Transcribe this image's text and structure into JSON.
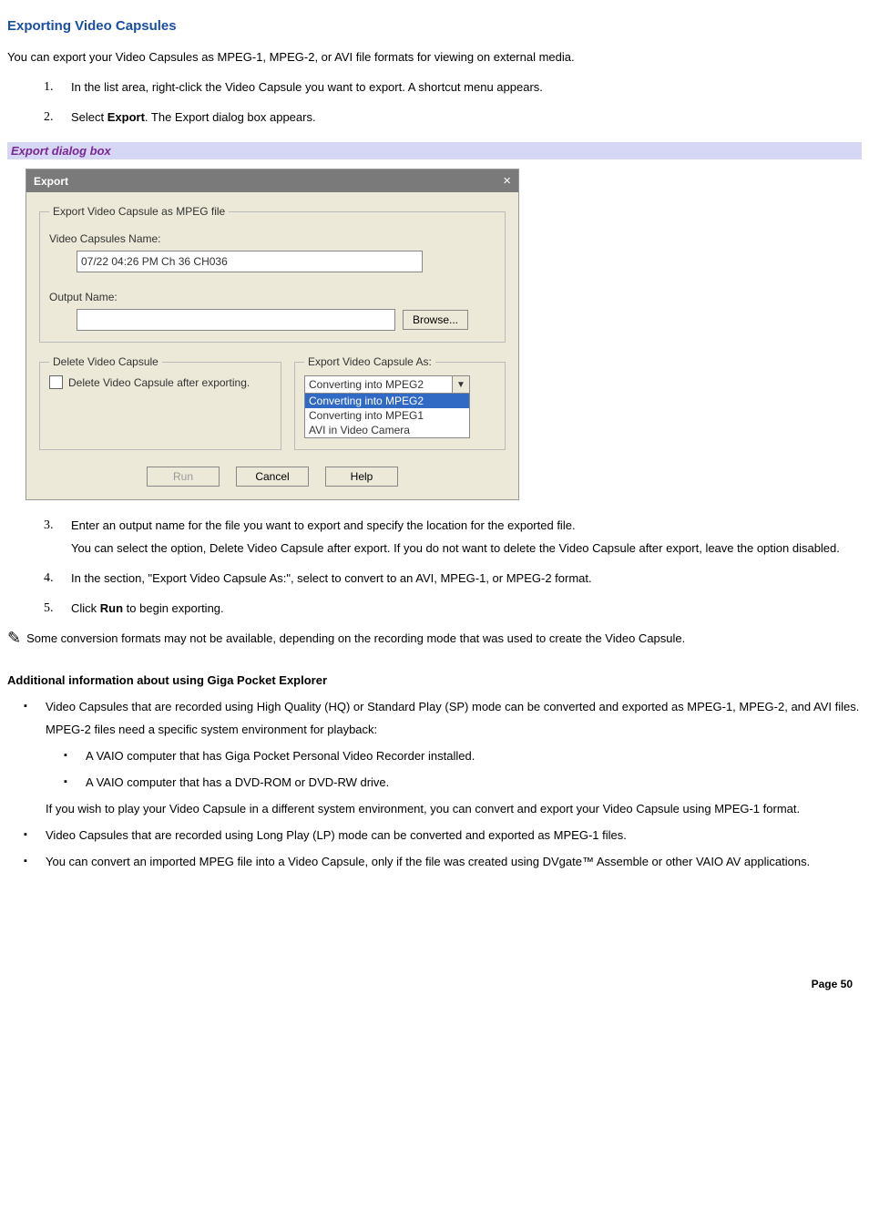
{
  "heading": "Exporting Video Capsules",
  "intro": "You can export your Video Capsules as MPEG-1, MPEG-2, or AVI file formats for viewing on external media.",
  "steps_a": [
    {
      "num": "1.",
      "text": "In the list area, right-click the Video Capsule you want to export. A shortcut menu appears."
    },
    {
      "num": "2.",
      "pre": "Select ",
      "bold": "Export",
      "post": ". The Export dialog box appears."
    }
  ],
  "caption": "Export dialog box",
  "dialog": {
    "title": "Export",
    "close": "×",
    "fs_main_legend": "Export Video Capsule as MPEG file",
    "capsule_label": "Video Capsules Name:",
    "capsule_value": "07/22 04:26 PM Ch 36 CH036",
    "output_label": "Output Name:",
    "output_value": "",
    "browse": "Browse...",
    "fs_delete_legend": "Delete Video Capsule",
    "delete_checkbox": "Delete Video Capsule after exporting.",
    "fs_export_legend": "Export Video Capsule As:",
    "combo_value": "Converting into MPEG2",
    "combo_options": [
      "Converting into MPEG2",
      "Converting into MPEG1",
      "AVI in Video Camera"
    ],
    "combo_selected_index": 0,
    "btn_run": "Run",
    "btn_cancel": "Cancel",
    "btn_help": "Help"
  },
  "steps_b": [
    {
      "num": "3.",
      "paras": [
        "Enter an output name for the file you want to export and specify the location for the exported file.",
        "You can select the option, Delete Video Capsule after export. If you do not want to delete the Video Capsule after export, leave the option disabled."
      ]
    },
    {
      "num": "4.",
      "paras": [
        "In the section, \"Export Video Capsule As:\", select to convert to an AVI, MPEG-1, or MPEG-2 format."
      ]
    },
    {
      "num": "5.",
      "pre": "Click ",
      "bold": "Run",
      "post": " to begin exporting."
    }
  ],
  "note_icon": "✎",
  "note_text": "Some conversion formats may not be available, depending on the recording mode that was used to create the Video Capsule.",
  "subhead": "Additional information about using Giga Pocket Explorer",
  "info": [
    {
      "paras": [
        "Video Capsules that are recorded using High Quality (HQ) or Standard Play (SP) mode can be converted and exported as MPEG-1, MPEG-2, and AVI files.",
        "MPEG-2 files need a specific system environment for playback:"
      ],
      "sub": [
        "A VAIO computer that has Giga Pocket Personal Video Recorder installed.",
        "A VAIO computer that has a DVD-ROM or DVD-RW drive."
      ],
      "tail": "If you wish to play your Video Capsule in a different system environment, you can convert and export your Video Capsule using MPEG-1 format."
    },
    {
      "paras": [
        "Video Capsules that are recorded using Long Play (LP) mode can be converted and exported as MPEG-1 files."
      ]
    },
    {
      "paras": [
        "You can convert an imported MPEG file into a Video Capsule, only if the file was created using DVgate™ Assemble or other VAIO AV applications."
      ]
    }
  ],
  "footer": "Page 50"
}
